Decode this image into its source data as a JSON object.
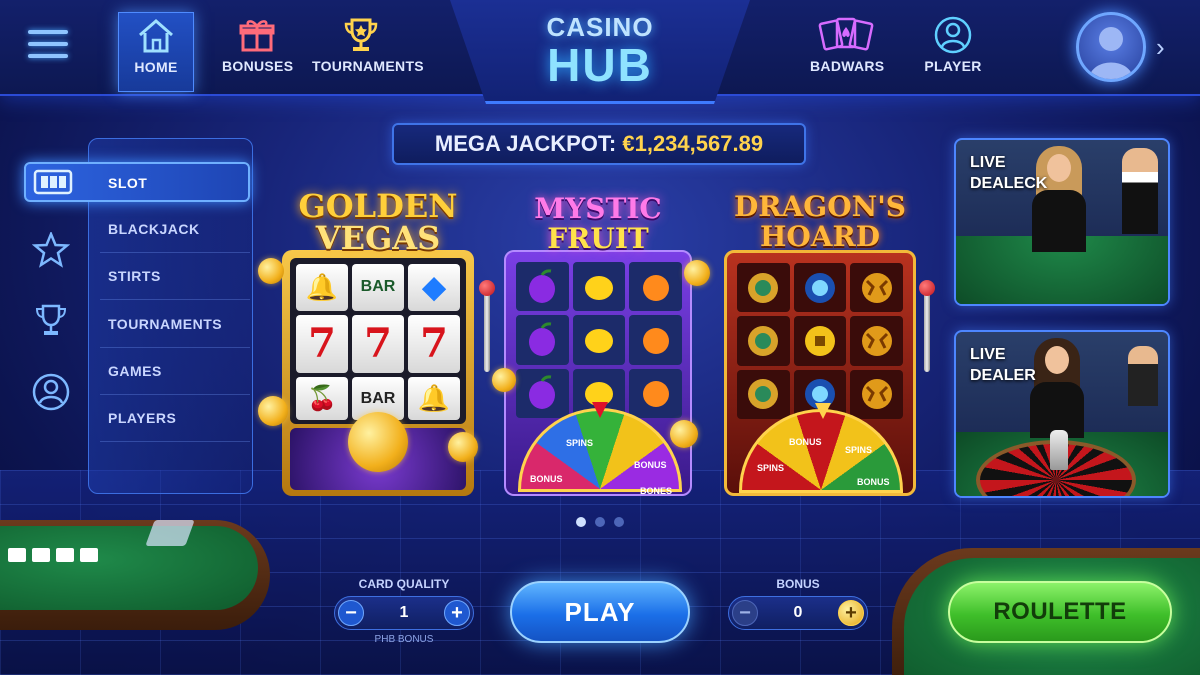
{
  "header": {
    "logo_line1": "CASINO",
    "logo_line2": "HUB",
    "nav": [
      {
        "label": "HOME",
        "icon": "home-icon",
        "active": true
      },
      {
        "label": "BONUSES",
        "icon": "gift-icon"
      },
      {
        "label": "TOURNAMENTS",
        "icon": "trophy-icon"
      },
      {
        "label": "BADWARS",
        "icon": "cards-icon"
      },
      {
        "label": "PLAYER",
        "icon": "player-icon"
      }
    ]
  },
  "sidebar": {
    "items": [
      {
        "label": "SLOT",
        "active": true
      },
      {
        "label": "BLACKJACK"
      },
      {
        "label": "STIRTS"
      },
      {
        "label": "TOURNAMENTS"
      },
      {
        "label": "GAMES"
      },
      {
        "label": "PLAYERS"
      }
    ],
    "icons": [
      "slot-icon",
      "star-icon",
      "trophy-icon",
      "user-icon"
    ]
  },
  "jackpot": {
    "label": "MEGA JACKPOT:",
    "amount": "€1,234,567.89"
  },
  "machines": [
    {
      "title_line1": "GOLDEN",
      "title_line2": "VEGAS",
      "symbols": [
        "🔔",
        "BAR",
        "◆",
        "7",
        "7",
        "7",
        "🍒",
        "BAR",
        "🔔"
      ]
    },
    {
      "title_line1": "MYSTIC",
      "title_line2": "FRUIT",
      "wheel_labels": [
        "BONUS",
        "SPINS",
        "BONUS",
        "BONES"
      ]
    },
    {
      "title_line1": "DRAGON'S",
      "title_line2": "HOARD",
      "wheel_labels": [
        "SPINS",
        "BONUS",
        "SPINS",
        "BONUS"
      ]
    }
  ],
  "live": [
    {
      "line1": "LIVE",
      "line2": "DEALECK"
    },
    {
      "line1": "LIVE",
      "line2": "DEALER"
    }
  ],
  "carousel": {
    "count": 3,
    "active": 0
  },
  "controls": {
    "card_quality_label": "CARD QUALITY",
    "card_quality_value": "1",
    "card_quality_sub": "PHB BONUS",
    "bonus_label": "BONUS",
    "bonus_value": "0",
    "minus": "−",
    "plus": "+",
    "play_label": "PLAY",
    "roulette_label": "ROULETTE"
  },
  "colors": {
    "accent": "#3f74e8",
    "jackpot_amount": "#ffd34d",
    "play": "#1b6fe8",
    "roulette": "#3fbf2a"
  }
}
